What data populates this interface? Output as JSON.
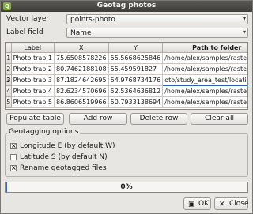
{
  "window": {
    "title": "Geotag photos",
    "icon_letter": "Q"
  },
  "vector_layer": {
    "label": "Vector layer",
    "value": "points-photo"
  },
  "label_field": {
    "label": "Label field",
    "value": "Name"
  },
  "table": {
    "headers": [
      "Label",
      "X",
      "Y",
      "Path to folder"
    ],
    "rows": [
      {
        "num": "1",
        "label": "Photo trap 1",
        "x": "75.6508578226",
        "y": "55.5668625846",
        "path": "/home/alex/samples/raster/geo..."
      },
      {
        "num": "2",
        "label": "Photo trap 2",
        "x": "80.7462188108",
        "y": "55.459591827",
        "path": "/home/alex/samples/raster/geo..."
      },
      {
        "num": "3",
        "label": "Photo trap 3",
        "x": "87.1824642695",
        "y": "54.9768734176",
        "path": "oto/study_area_test/location3"
      },
      {
        "num": "4",
        "label": "Photo trap 4",
        "x": "82.6234570696",
        "y": "52.5364636812",
        "path": "/home/alex/samples/raster/geo..."
      },
      {
        "num": "5",
        "label": "Photo trap 5",
        "x": "86.8606519966",
        "y": "50.7933138694",
        "path": "/home/alex/samples/raster/geo..."
      }
    ],
    "editor_button": "..."
  },
  "buttons": {
    "populate": "Populate table",
    "add": "Add row",
    "delete": "Delete row",
    "clear": "Clear all"
  },
  "options": {
    "title": "Geotagging options",
    "longitude": {
      "label": "Longitude E (by default W)",
      "checked": true
    },
    "latitude": {
      "label": "Latitude S (by default N)",
      "checked": false
    },
    "rename": {
      "label": "Rename geotagged files",
      "checked": true
    }
  },
  "progress": {
    "text": "0%",
    "value": 0
  },
  "dialog": {
    "ok": "OK",
    "close": "Close"
  },
  "colors": {
    "accent": "#3d68b5",
    "titlebar": "#4a4845"
  }
}
